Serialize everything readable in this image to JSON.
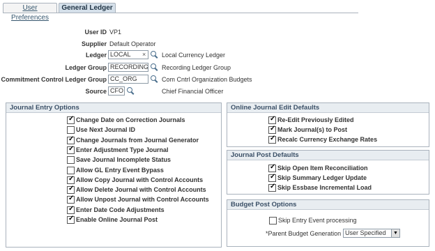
{
  "tabs": [
    {
      "label": "User Preferences",
      "active": false
    },
    {
      "label": "General Ledger",
      "active": true
    }
  ],
  "header": {
    "user_id_label": "User ID",
    "user_id_value": "VP1",
    "supplier_label": "Supplier",
    "supplier_value": "Default Operator",
    "ledger_label": "Ledger",
    "ledger_value": "LOCAL",
    "ledger_desc": "Local Currency Ledger",
    "ledger_group_label": "Ledger Group",
    "ledger_group_value": "RECORDING",
    "ledger_group_desc": "Recording Ledger Group",
    "cc_ledger_group_label": "Commitment Control Ledger Group",
    "cc_ledger_group_value": "CC_ORG",
    "cc_ledger_group_desc": "Com Cntrl Organization Budgets",
    "source_label": "Source",
    "source_value": "CFO",
    "source_desc": "Chief Financial Officer",
    "clear_icon": "×"
  },
  "journal_entry_options": {
    "title": "Journal Entry Options",
    "items": [
      {
        "label": "Change Date on Correction Journals",
        "checked": true
      },
      {
        "label": "Use Next Journal ID",
        "checked": false
      },
      {
        "label": "Change Journals from Journal Generator",
        "checked": true
      },
      {
        "label": "Enter Adjustment Type Journal",
        "checked": true
      },
      {
        "label": "Save Journal Incomplete Status",
        "checked": false
      },
      {
        "label": "Allow GL Entry Event Bypass",
        "checked": false
      },
      {
        "label": "Allow Copy Journal with Control Accounts",
        "checked": true
      },
      {
        "label": "Allow Delete Journal with Control Accounts",
        "checked": true
      },
      {
        "label": "Allow Unpost Journal with Control Accounts",
        "checked": true
      },
      {
        "label": "Enter Date Code Adjustments",
        "checked": true
      },
      {
        "label": "Enable Online Journal Post",
        "checked": true
      }
    ]
  },
  "online_journal_edit_defaults": {
    "title": "Online Journal Edit Defaults",
    "items": [
      {
        "label": "Re-Edit Previously Edited",
        "checked": true
      },
      {
        "label": "Mark Journal(s) to Post",
        "checked": true
      },
      {
        "label": "Recalc Currency Exchange Rates",
        "checked": true
      }
    ]
  },
  "journal_post_defaults": {
    "title": "Journal Post Defaults",
    "items": [
      {
        "label": "Skip Open Item Reconciliation",
        "checked": true
      },
      {
        "label": "Skip Summary Ledger Update",
        "checked": true
      },
      {
        "label": "Skip Essbase Incremental Load",
        "checked": true
      }
    ]
  },
  "budget_post_options": {
    "title": "Budget Post Options",
    "skip_entry_event_label": "Skip Entry Event processing",
    "skip_entry_event_checked": false,
    "parent_budget_label": "*Parent Budget Generation",
    "parent_budget_value": "User Specified",
    "dropdown_arrow": "▼"
  }
}
